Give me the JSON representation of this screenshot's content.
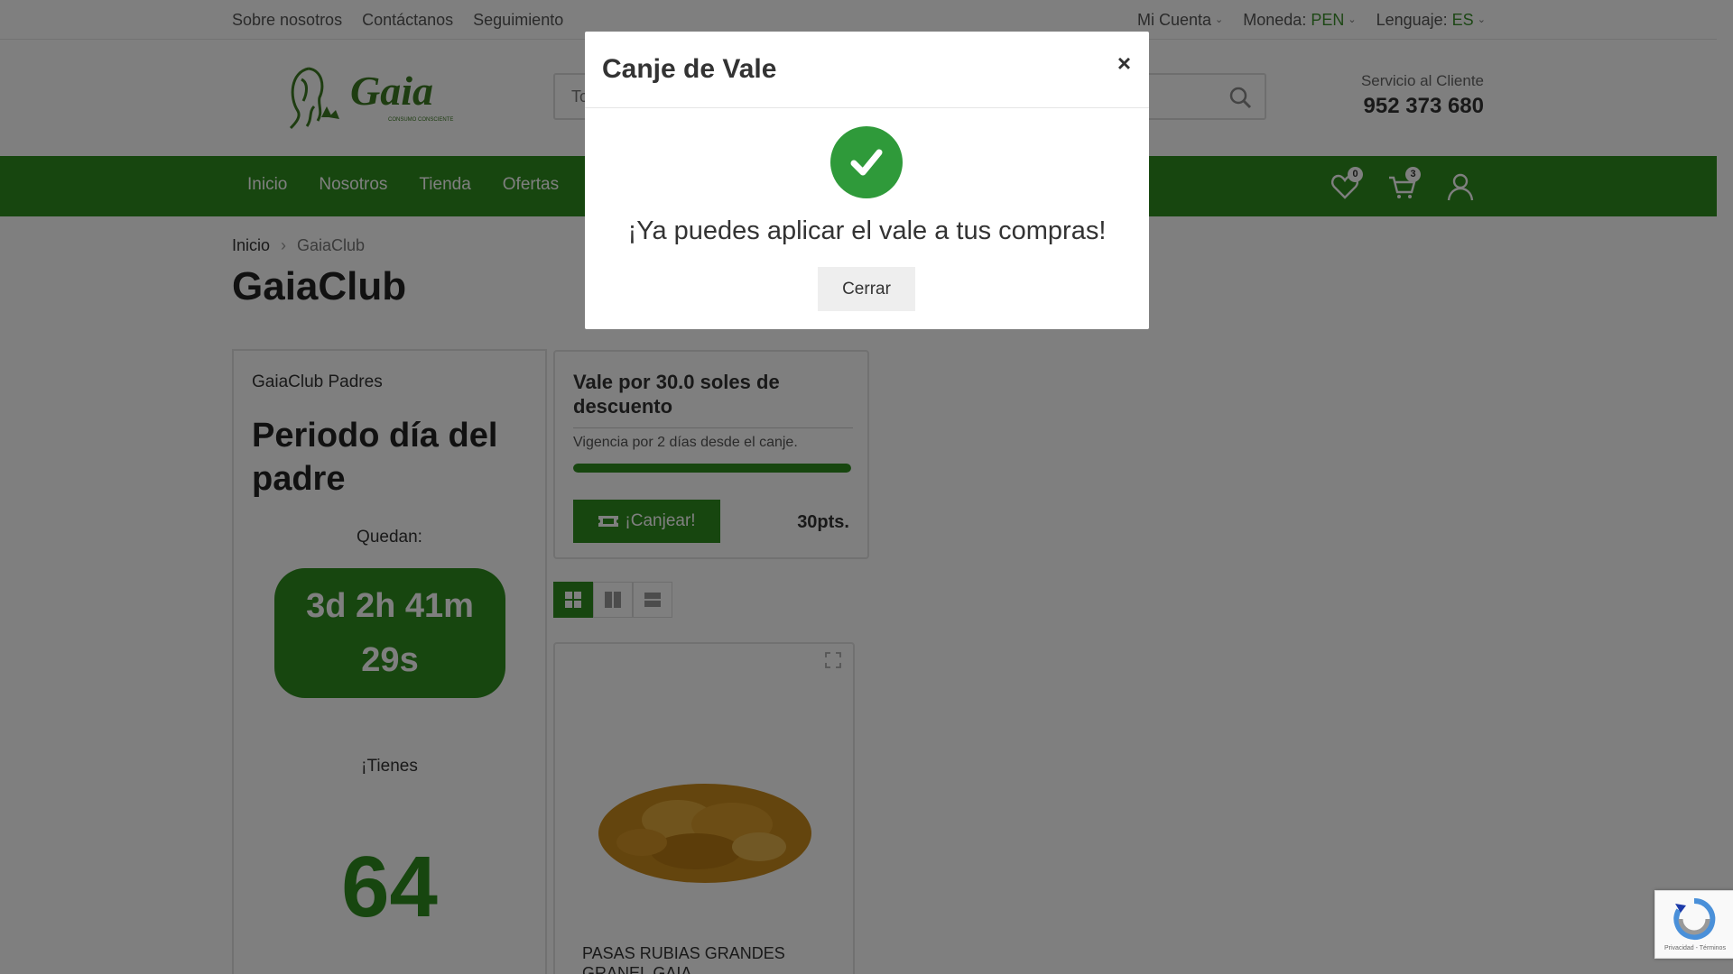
{
  "topbar": {
    "links": [
      "Sobre nosotros",
      "Contáctanos",
      "Seguimiento"
    ],
    "account": "Mi Cuenta",
    "currency_label": "Moneda:",
    "currency_value": "PEN",
    "language_label": "Lenguaje:",
    "language_value": "ES"
  },
  "header": {
    "logo_text": "Gaia",
    "logo_tagline": "CONSUMO CONSCIENTE",
    "search_placeholder": "To",
    "service_label": "Servicio al Cliente",
    "service_phone": "952 373 680"
  },
  "nav": {
    "items": [
      "Inicio",
      "Nosotros",
      "Tienda",
      "Ofertas"
    ],
    "wishlist_count": "0",
    "cart_count": "3"
  },
  "breadcrumb": {
    "home": "Inicio",
    "current": "GaiaClub"
  },
  "page_title": "GaiaClub",
  "club": {
    "name": "GaiaClub Padres",
    "period": "Periodo día del padre",
    "remaining_label": "Quedan:",
    "timer": "3d 2h 41m 29s",
    "have_label": "¡Tienes",
    "points": "64"
  },
  "voucher": {
    "title": "Vale por 30.0 soles de descuento",
    "validity": "Vigencia por 2 días desde el canje.",
    "progress": 1.0,
    "button": "¡Canjear!",
    "cost": "30pts."
  },
  "product": {
    "name": "PASAS RUBIAS GRANDES GRANEL GAIA"
  },
  "modal": {
    "title": "Canje de Vale",
    "close_symbol": "×",
    "message": "¡Ya puedes aplicar el vale a tus compras!",
    "button": "Cerrar"
  },
  "recaptcha": {
    "legal": "Privacidad - Términos"
  },
  "colors": {
    "brand_green": "#2f8c1f",
    "success_green": "#2f9a3a"
  }
}
